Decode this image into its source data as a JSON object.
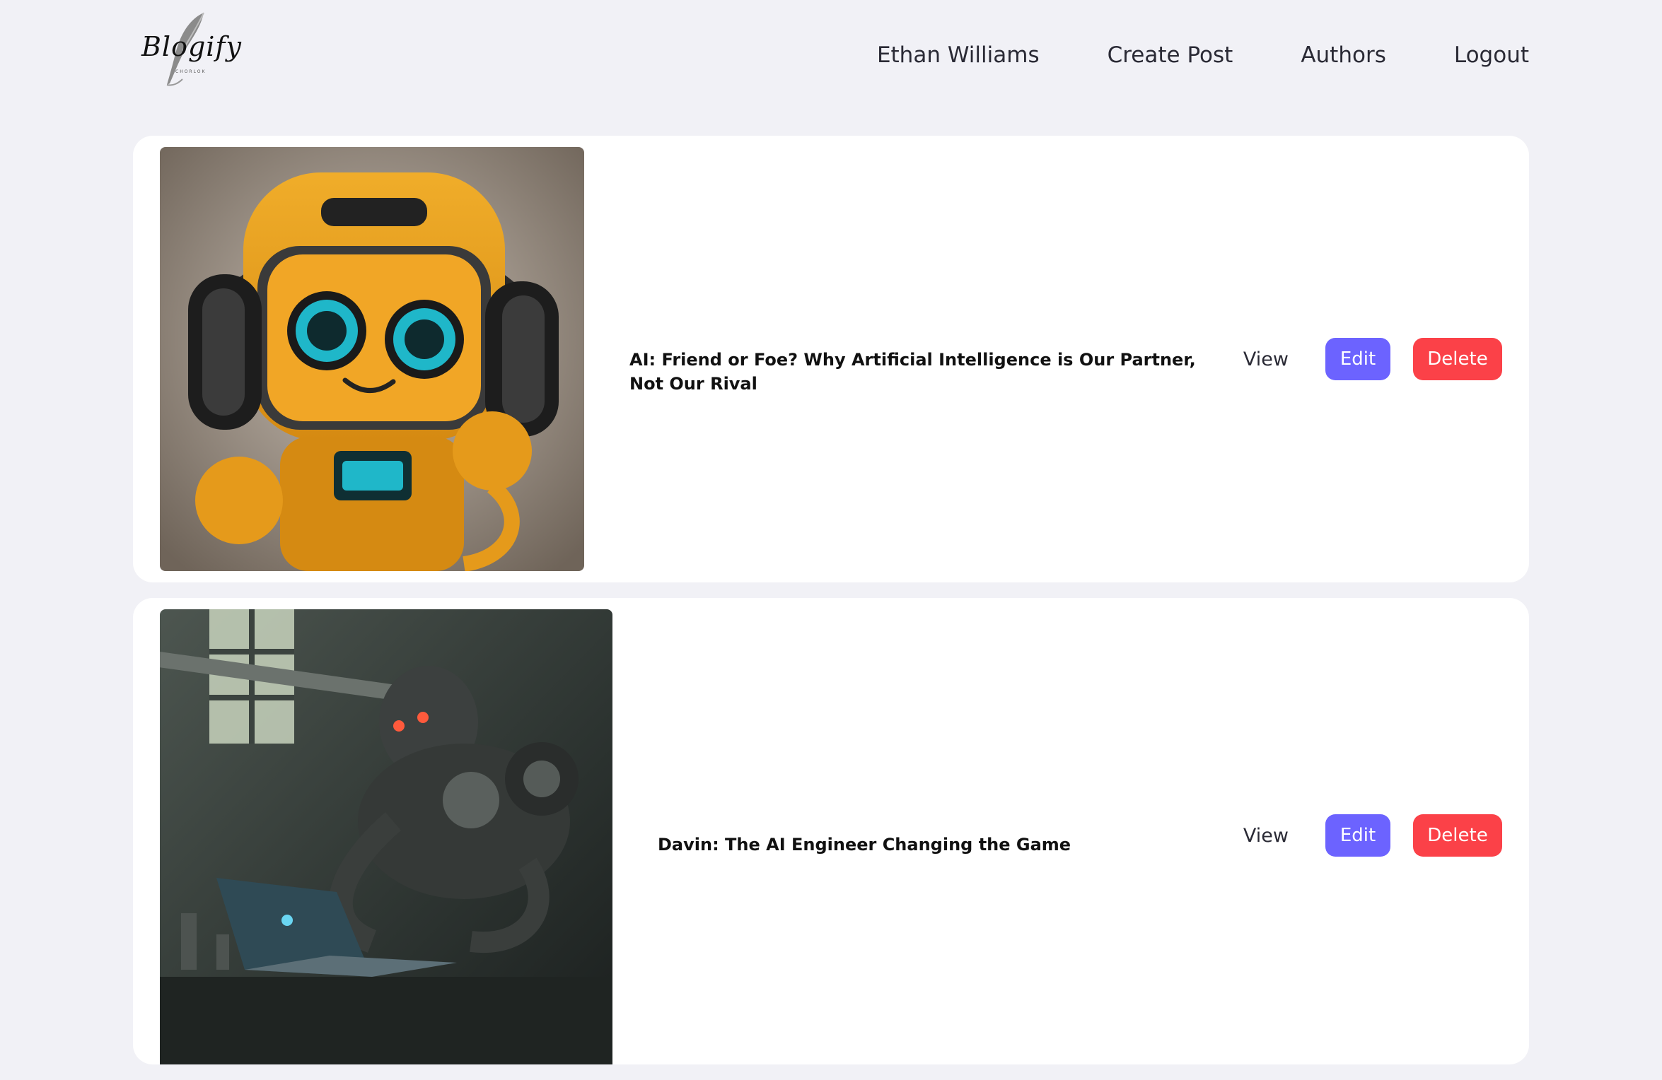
{
  "brand": {
    "name": "Blogify",
    "tagline": "CHORLOK"
  },
  "nav": {
    "items": [
      {
        "label": "Ethan Williams"
      },
      {
        "label": "Create Post"
      },
      {
        "label": "Authors"
      },
      {
        "label": "Logout"
      }
    ]
  },
  "posts": [
    {
      "title": "AI: Friend or Foe? Why Artificial Intelligence is Our Partner, Not Our Rival",
      "image": "robot-headphones-image",
      "view_label": "View",
      "edit_label": "Edit",
      "delete_label": "Delete"
    },
    {
      "title": "Davin: The AI Engineer Changing the Game",
      "image": "robot-laptop-image",
      "view_label": "View",
      "edit_label": "Edit",
      "delete_label": "Delete"
    }
  ],
  "colors": {
    "page_background": "#f1f1f6",
    "card_background": "#ffffff",
    "edit_button": "#6c63ff",
    "delete_button": "#fb4148"
  }
}
